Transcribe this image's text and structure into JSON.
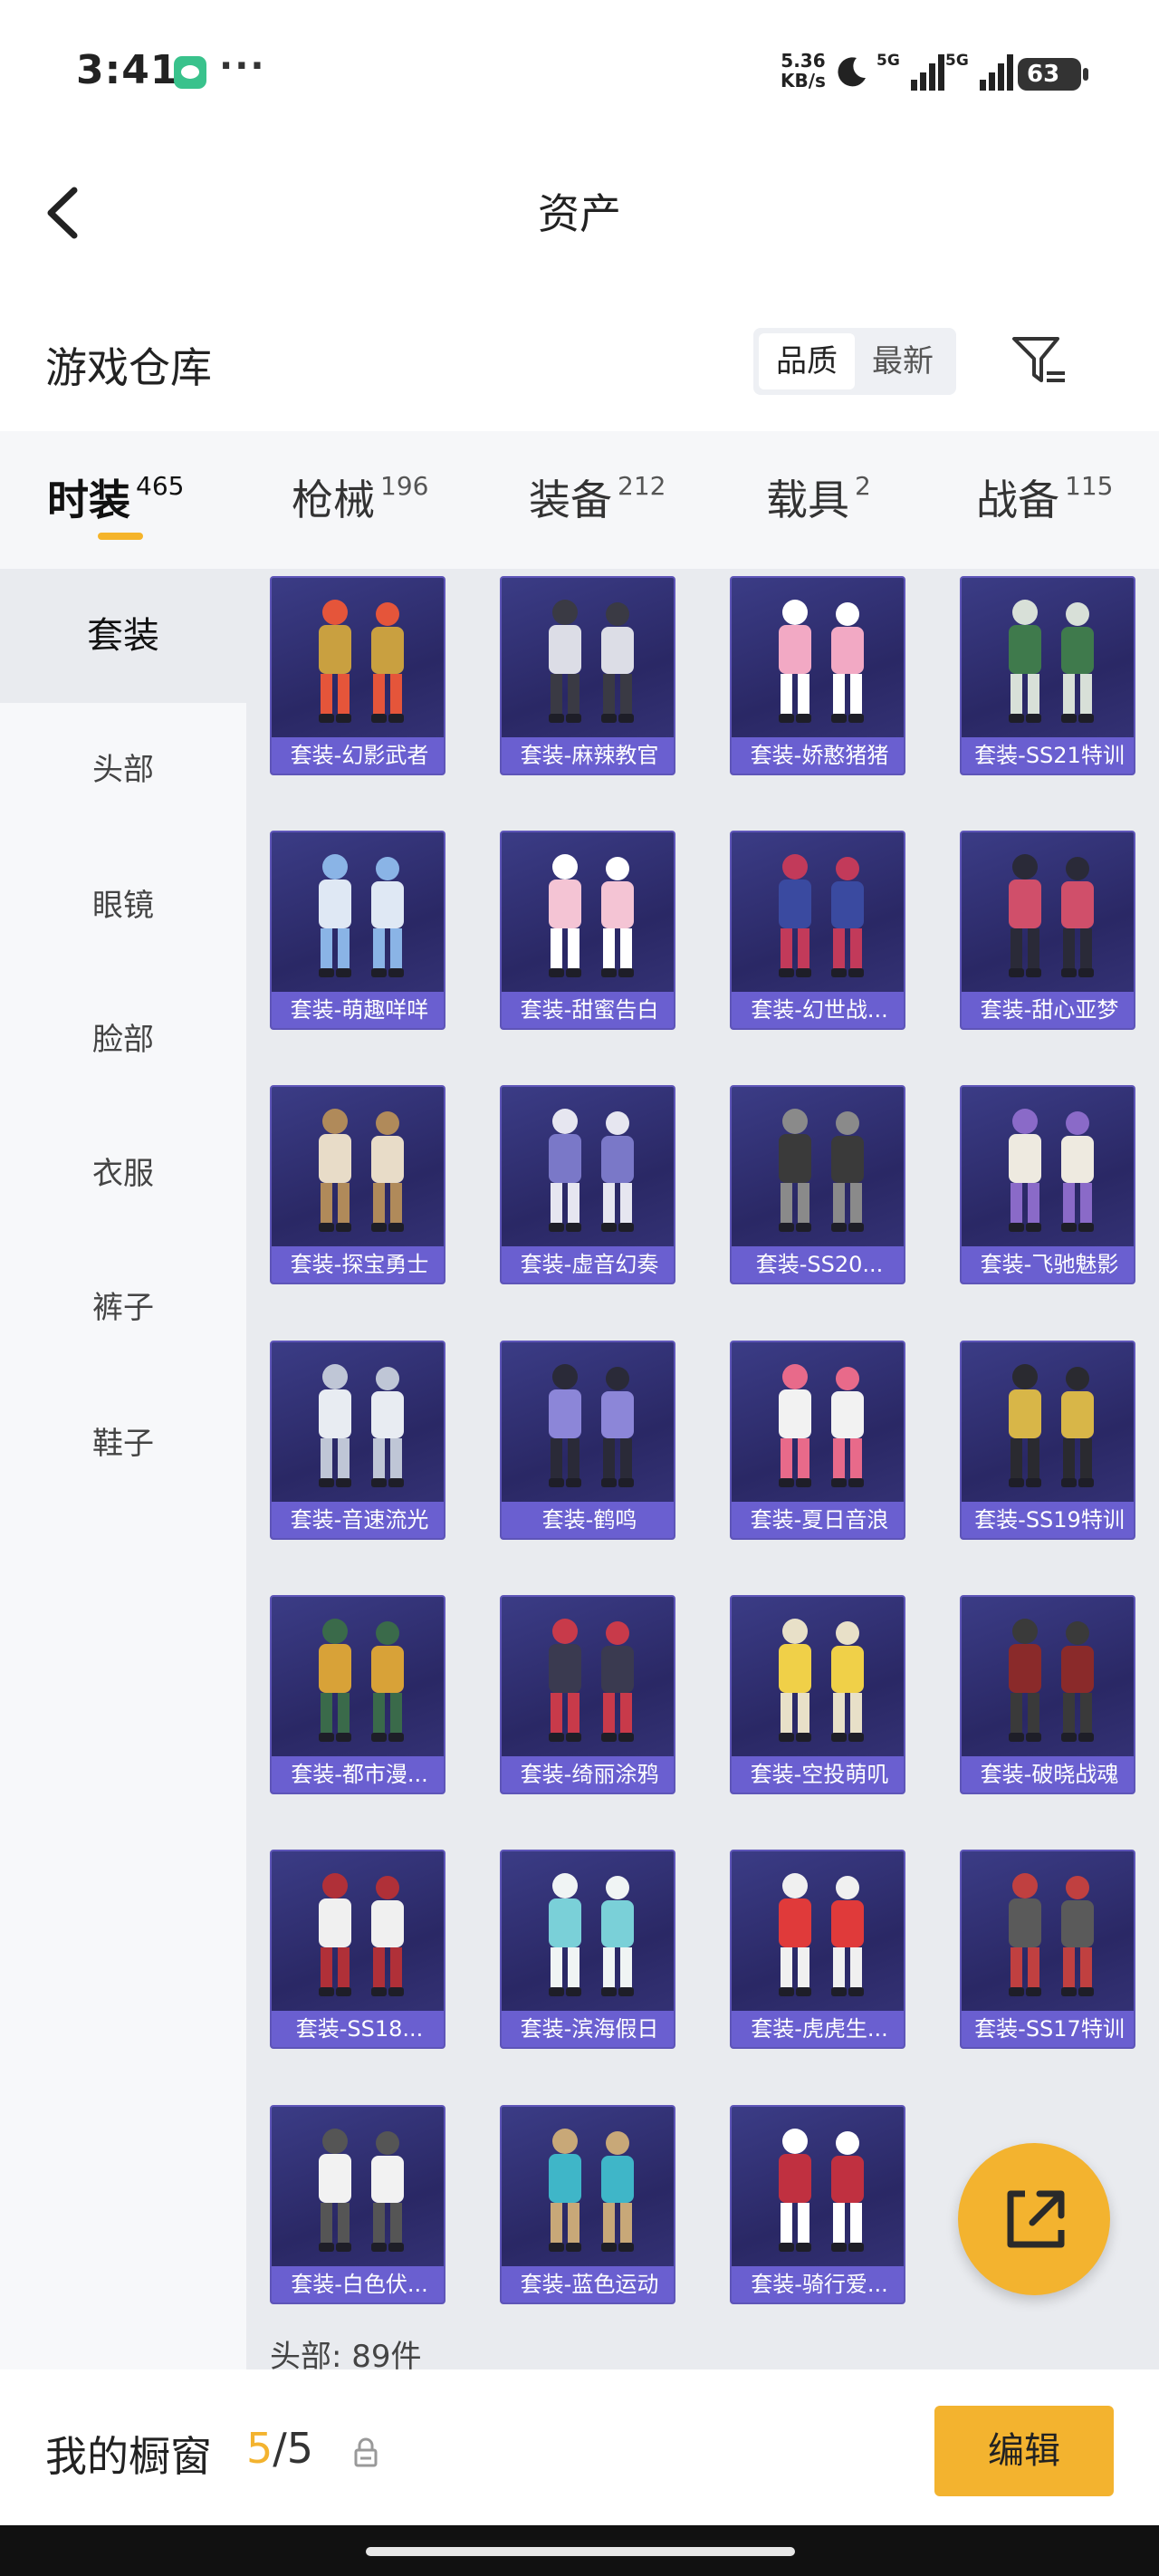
{
  "status": {
    "time": "3:41",
    "net_speed_value": "5.36",
    "net_speed_unit": "KB/s",
    "sig1_label": "5G",
    "sig2_label": "5G",
    "battery": "63"
  },
  "nav": {
    "title": "资产"
  },
  "warehouse": {
    "title": "游戏仓库",
    "sort_options": [
      "品质",
      "最新"
    ]
  },
  "tabs": [
    {
      "label": "时装",
      "count": "465"
    },
    {
      "label": "枪械",
      "count": "196"
    },
    {
      "label": "装备",
      "count": "212"
    },
    {
      "label": "载具",
      "count": "2"
    },
    {
      "label": "战备",
      "count": "115"
    }
  ],
  "sidebar": {
    "items": [
      "套装",
      "头部",
      "眼镜",
      "脸部",
      "衣服",
      "裤子",
      "鞋子"
    ]
  },
  "grid": {
    "items": [
      "套装-幻影武者",
      "套装-麻辣教官",
      "套装-娇憨猪猪",
      "套装-SS21特训",
      "套装-萌趣咩咩",
      "套装-甜蜜告白",
      "套装-幻世战...",
      "套装-甜心亚梦",
      "套装-探宝勇士",
      "套装-虚音幻奏",
      "套装-SS20...",
      "套装-飞驰魅影",
      "套装-音速流光",
      "套装-鹤鸣",
      "套装-夏日音浪",
      "套装-SS19特训",
      "套装-都市漫...",
      "套装-绮丽涂鸦",
      "套装-空投萌叽",
      "套装-破晓战魂",
      "套装-SS18...",
      "套装-滨海假日",
      "套装-虎虎生...",
      "套装-SS17特训",
      "套装-白色伏...",
      "套装-蓝色运动",
      "套装-骑行爱..."
    ],
    "note": "头部: 89件"
  },
  "showcase": {
    "label": "我的橱窗",
    "current": "5",
    "sep": "/",
    "total": "5",
    "edit_label": "编辑"
  },
  "colors": {
    "accent": "#f3b32f",
    "card_bg": "#2a2865",
    "card_caption": "#6a5fd0"
  }
}
